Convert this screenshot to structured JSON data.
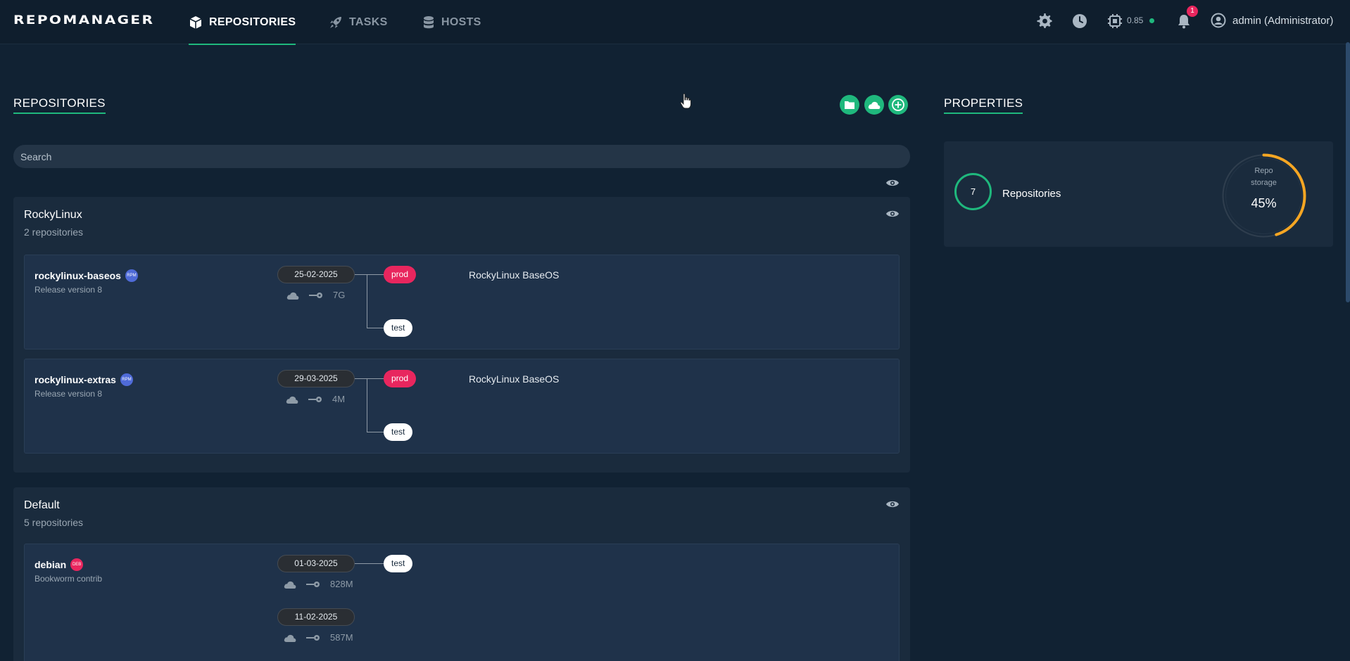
{
  "app": {
    "logo": "REPOMANAGER"
  },
  "nav": {
    "tabs": [
      {
        "label": "REPOSITORIES",
        "icon": "cube-icon",
        "active": true
      },
      {
        "label": "TASKS",
        "icon": "rocket-icon",
        "active": false
      },
      {
        "label": "HOSTS",
        "icon": "database-icon",
        "active": false
      }
    ],
    "cpu_load": "0.85",
    "notifications_count": "1",
    "user": "admin (Administrator)"
  },
  "repositories": {
    "title": "REPOSITORIES",
    "search_placeholder": "Search",
    "groups": [
      {
        "name": "RockyLinux",
        "count": "2 repositories",
        "repos": [
          {
            "name": "rockylinux-baseos",
            "type": "RPM",
            "description": "Release version 8",
            "snapshots": [
              {
                "date": "25-02-2025",
                "size": "7G"
              }
            ],
            "environments": [
              {
                "name": "prod",
                "description": "RockyLinux BaseOS"
              },
              {
                "name": "test",
                "description": ""
              }
            ]
          },
          {
            "name": "rockylinux-extras",
            "type": "RPM",
            "description": "Release version 8",
            "snapshots": [
              {
                "date": "29-03-2025",
                "size": "4M"
              }
            ],
            "environments": [
              {
                "name": "prod",
                "description": "RockyLinux BaseOS"
              },
              {
                "name": "test",
                "description": ""
              }
            ]
          }
        ]
      },
      {
        "name": "Default",
        "count": "5 repositories",
        "repos": [
          {
            "name": "debian",
            "type": "DEB",
            "description": "Bookworm contrib",
            "snapshots": [
              {
                "date": "01-03-2025",
                "size": "828M"
              },
              {
                "date": "11-02-2025",
                "size": "587M"
              }
            ],
            "environments": [
              {
                "name": "test",
                "description": ""
              }
            ]
          }
        ]
      }
    ]
  },
  "properties": {
    "title": "PROPERTIES",
    "repo_count": "7",
    "repo_count_label": "Repositories",
    "storage_label_1": "Repo",
    "storage_label_2": "storage",
    "storage_percent": 45,
    "storage_percent_text": "45%"
  },
  "colors": {
    "accent": "#1fb87d",
    "prod": "#e8265e",
    "rpm_badge": "#4f6bd8",
    "deb_badge": "#e8265e",
    "gauge": "#f5a623"
  }
}
